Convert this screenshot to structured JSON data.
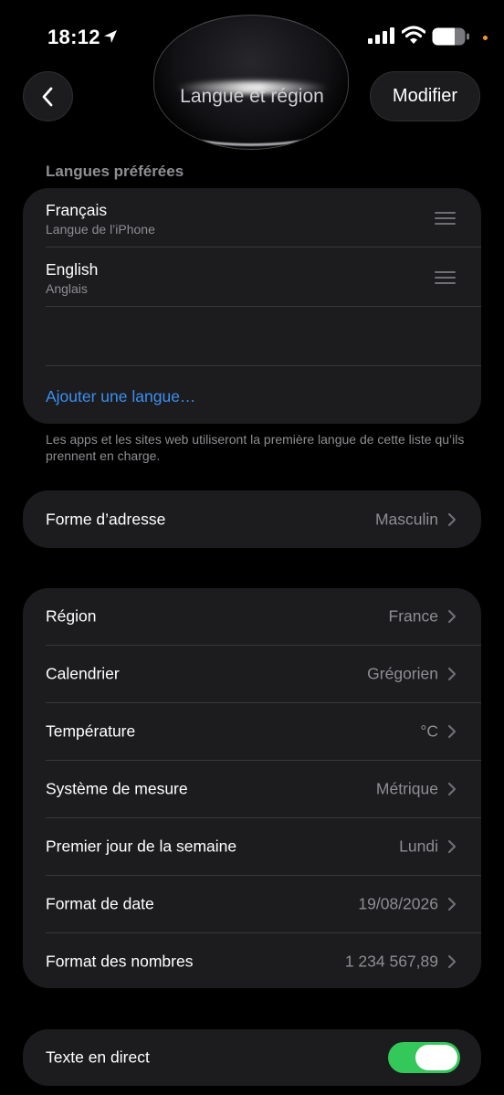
{
  "status_bar": {
    "time": "18:12",
    "icons": [
      "location-arrow-icon",
      "cellular-signal-icon",
      "wifi-icon",
      "battery-icon"
    ],
    "privacy_dot_color": "#f0943a"
  },
  "nav": {
    "title": "Langue et région",
    "back_icon": "chevron-left-icon",
    "edit_label": "Modifier"
  },
  "preferred_languages": {
    "header": "Langues préférées",
    "items": [
      {
        "name": "Français",
        "subtitle": "Langue de l’iPhone"
      },
      {
        "name": "English",
        "subtitle": "Anglais"
      }
    ],
    "add_label": "Ajouter une langue…",
    "footnote": "Les apps et les sites web utiliseront la première langue de cette liste qu’ils prennent en charge."
  },
  "address_form": {
    "label": "Forme d’adresse",
    "value": "Masculin"
  },
  "region_settings": [
    {
      "label": "Région",
      "value": "France"
    },
    {
      "label": "Calendrier",
      "value": "Grégorien"
    },
    {
      "label": "Température",
      "value": "°C"
    },
    {
      "label": "Système de mesure",
      "value": "Métrique"
    },
    {
      "label": "Premier jour de la semaine",
      "value": "Lundi"
    },
    {
      "label": "Format de date",
      "value": "19/08/2026"
    },
    {
      "label": "Format des nombres",
      "value": "1 234 567,89"
    }
  ],
  "live_text": {
    "label": "Texte en direct",
    "enabled": true
  },
  "colors": {
    "accent_link": "#3b8ff0",
    "toggle_on": "#34c759",
    "card_bg": "#1c1c1e",
    "secondary_text": "#8e8e93"
  }
}
